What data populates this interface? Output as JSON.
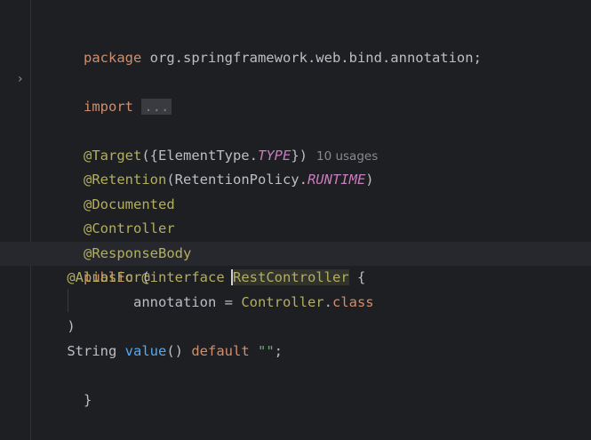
{
  "editor": {
    "lines": {
      "l1": {
        "kw": "package",
        "rest": " org.springframework.web.bind.annotation;"
      },
      "l3": {
        "kw": "import",
        "fold": "..."
      },
      "l5": {
        "ann": "@Target",
        "open": "({ElementType.",
        "it": "TYPE",
        "close": "})",
        "hint": "10 usages"
      },
      "l6": {
        "ann": "@Retention",
        "open": "(RetentionPolicy.",
        "it": "RUNTIME",
        "close": ")"
      },
      "l7": {
        "ann": "@Documented"
      },
      "l8": {
        "ann": "@Controller"
      },
      "l9": {
        "ann": "@ResponseBody"
      },
      "l10": {
        "kw1": "public",
        "ann": "@interface",
        "name": "RestController",
        "brace": " {"
      },
      "l11": {
        "ann": "@AliasFor",
        "open": "("
      },
      "l12": {
        "param": "annotation = ",
        "ref": "Controller",
        "dot": ".",
        "kw": "class"
      },
      "l13": {
        "close": ")"
      },
      "l14": {
        "type": "String ",
        "fn": "value",
        "parens": "() ",
        "kw": "default",
        "space": " ",
        "str": "\"\"",
        "semi": ";"
      },
      "l15": {
        "close": "}"
      }
    }
  }
}
